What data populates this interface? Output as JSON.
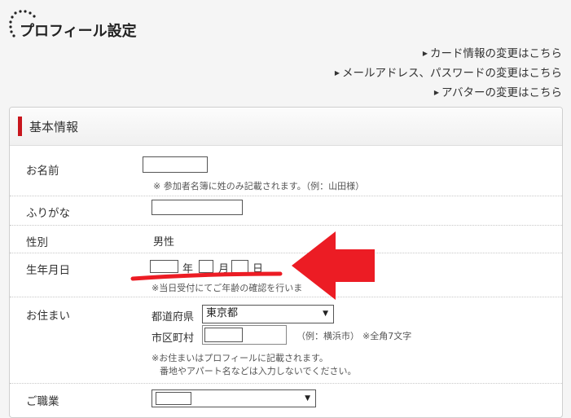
{
  "header": {
    "title": "プロフィール設定"
  },
  "links": [
    {
      "label": "カード情報の変更はこちら"
    },
    {
      "label": "メールアドレス、パスワードの変更はこちら"
    },
    {
      "label": "アバターの変更はこちら"
    }
  ],
  "panel": {
    "title": "基本情報"
  },
  "form": {
    "name": {
      "label": "お名前",
      "value": "",
      "note": "※ 参加者名簿に姓のみ記載されます。（例：山田様）"
    },
    "furigana": {
      "label": "ふりがな",
      "value": ""
    },
    "gender": {
      "label": "性別",
      "value": "男性"
    },
    "birthdate": {
      "label": "生年月日",
      "year_unit": "年",
      "month_unit": "月",
      "day_unit": "日",
      "note": "※当日受付にてご年齢の確認を行いま"
    },
    "address": {
      "label": "お住まい",
      "prefecture_label": "都道府県",
      "prefecture_value": "東京都",
      "city_label": "市区町村",
      "city_value": "",
      "city_example": "（例：横浜市）",
      "city_limit": "※全角7文字",
      "note_line1": "※お住まいはプロフィールに記載されます。",
      "note_line2": "番地やアパート名などは入力しないでください。"
    },
    "occupation": {
      "label": "ご職業",
      "value": ""
    }
  },
  "colors": {
    "accent_red": "#c8161d",
    "arrow_red": "#ec1c24"
  }
}
